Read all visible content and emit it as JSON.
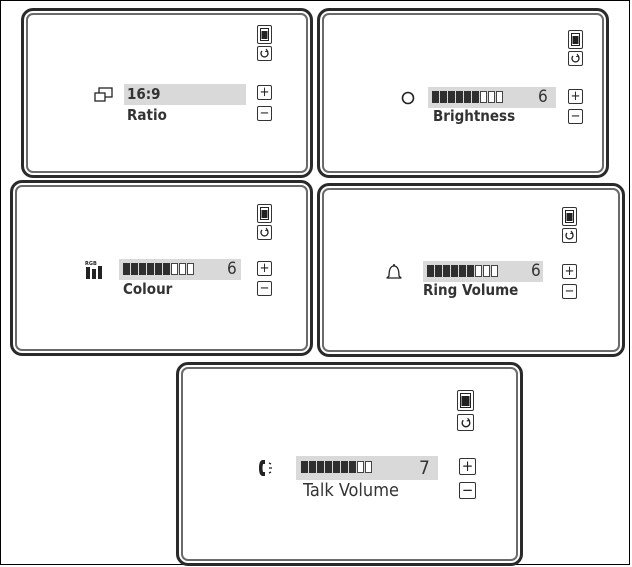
{
  "panels": {
    "ratio": {
      "value": "16:9",
      "label": "Ratio"
    },
    "brightness": {
      "value": "6",
      "label": "Brightness",
      "level": 6,
      "max": 9
    },
    "colour": {
      "value": "6",
      "label": "Colour",
      "level": 6,
      "max": 9,
      "icon_text": "RGB"
    },
    "ring": {
      "value": "6",
      "label": "Ring Volume",
      "level": 6,
      "max": 9
    },
    "talk": {
      "value": "7",
      "label": "Talk Volume",
      "level": 7,
      "max": 9
    }
  },
  "controls": {
    "plus": "+",
    "minus": "−",
    "save_icon": "save-icon",
    "undo_icon": "undo-icon"
  }
}
